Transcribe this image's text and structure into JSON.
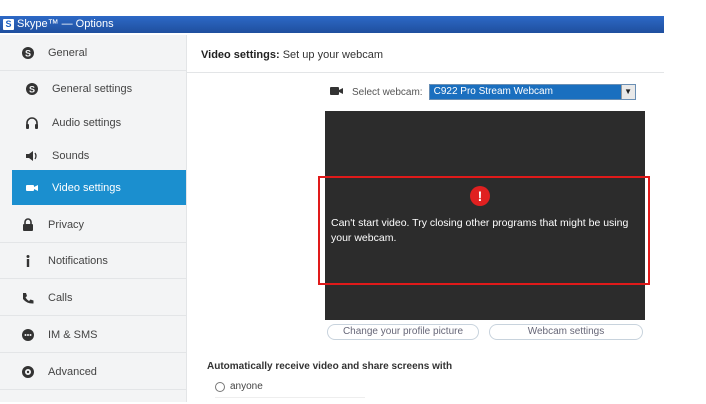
{
  "window": {
    "title": "Skype™ — Options"
  },
  "sidebar": {
    "items": [
      {
        "label": "General",
        "icon": "skype-icon"
      },
      {
        "label": "General settings",
        "icon": "skype-icon"
      },
      {
        "label": "Audio settings",
        "icon": "headset-icon"
      },
      {
        "label": "Sounds",
        "icon": "speaker-icon"
      },
      {
        "label": "Video settings",
        "icon": "video-camera-icon"
      },
      {
        "label": "Privacy",
        "icon": "lock-icon"
      },
      {
        "label": "Notifications",
        "icon": "info-icon"
      },
      {
        "label": "Calls",
        "icon": "phone-icon"
      },
      {
        "label": "IM & SMS",
        "icon": "chat-icon"
      },
      {
        "label": "Advanced",
        "icon": "gear-icon"
      }
    ]
  },
  "header": {
    "title": "Video settings:",
    "subtitle": "Set up your webcam"
  },
  "webcam": {
    "label": "Select webcam:",
    "selected": "C922 Pro Stream Webcam"
  },
  "preview": {
    "error_text": "Can't start video. Try closing other programs that might be using your webcam."
  },
  "buttons": {
    "profile": "Change your profile picture",
    "webcam_settings": "Webcam settings"
  },
  "auto_receive": {
    "label": "Automatically receive video and share screens with",
    "option_anyone": "anyone"
  },
  "colors": {
    "accent": "#1b8fcf",
    "error": "#e02020",
    "highlight_box": "#e01a1a"
  }
}
